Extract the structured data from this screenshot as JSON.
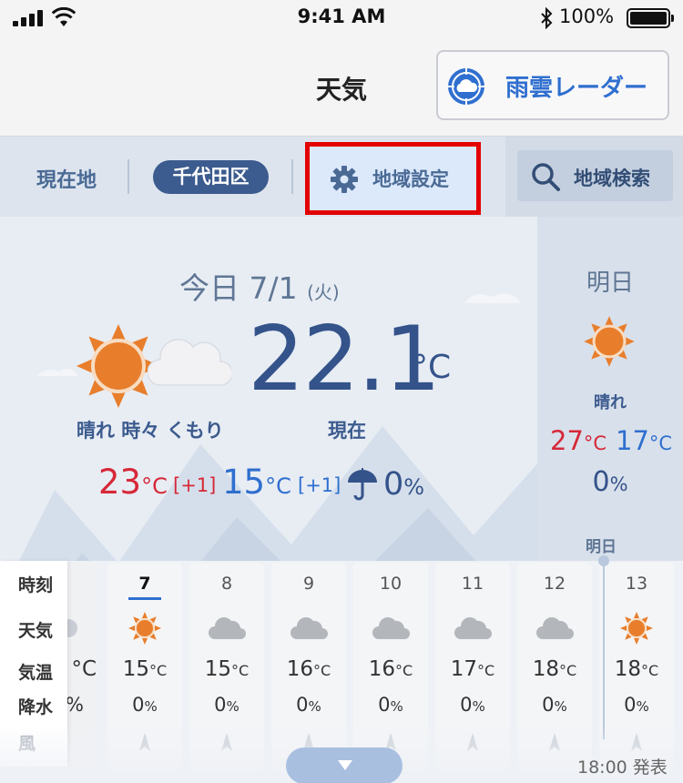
{
  "status_bar": {
    "time": "9:41 AM",
    "battery_percent": "100%",
    "icons": [
      "signal-icon",
      "wifi-icon",
      "bluetooth-icon",
      "battery-icon"
    ]
  },
  "header": {
    "title": "天気",
    "radar_button": {
      "label": "雨雲レーダー",
      "icon": "radar-cloud-icon"
    }
  },
  "location_tabs": {
    "current_location": "現在地",
    "selected_area": "千代田区",
    "area_settings": {
      "label": "地域設定",
      "icon": "gear-icon"
    },
    "area_search": {
      "label": "地域検索",
      "icon": "search-icon"
    }
  },
  "today": {
    "day_label": "今日 7/1",
    "weekday": "(火)",
    "weather_desc": "晴れ 時々 くもり",
    "current_temp": "22.1",
    "current_temp_unit": "°C",
    "current_label": "現在",
    "high_temp": "23",
    "high_diff": "[+1]",
    "low_temp": "15",
    "low_diff": "[+1]",
    "temp_unit": "°C",
    "rain_chance": "0",
    "rain_unit": "%"
  },
  "tomorrow": {
    "title": "明日",
    "weather_desc": "晴れ",
    "high_temp": "27",
    "low_temp": "17",
    "temp_unit": "°C",
    "rain_chance": "0",
    "rain_unit": "%"
  },
  "hourly": {
    "row_labels": {
      "time": "時刻",
      "weather": "天気",
      "temp": "気温",
      "rain": "降水",
      "wind": "風"
    },
    "day_marker": "明日",
    "temp_unit": "°C",
    "rain_unit": "%",
    "partial": {
      "temp_suffix": "°C",
      "rain_suffix": "%"
    },
    "hours": [
      {
        "hour": "7",
        "icon": "sun-icon",
        "temp": "15",
        "rain": "0"
      },
      {
        "hour": "8",
        "icon": "cloud-icon",
        "temp": "15",
        "rain": "0"
      },
      {
        "hour": "9",
        "icon": "cloud-icon",
        "temp": "16",
        "rain": "0"
      },
      {
        "hour": "10",
        "icon": "cloud-icon",
        "temp": "16",
        "rain": "0"
      },
      {
        "hour": "11",
        "icon": "cloud-icon",
        "temp": "17",
        "rain": "0"
      },
      {
        "hour": "12",
        "icon": "cloud-icon",
        "temp": "18",
        "rain": "0"
      },
      {
        "hour": "13",
        "icon": "sun-icon",
        "temp": "18",
        "rain": "0"
      }
    ],
    "issued_time": "18:00 発表"
  },
  "colors": {
    "accent_blue": "#2f6fcf",
    "navy": "#34538a",
    "high_red": "#d62838",
    "sun_orange": "#e87e2c",
    "highlight_border": "#e30000"
  }
}
